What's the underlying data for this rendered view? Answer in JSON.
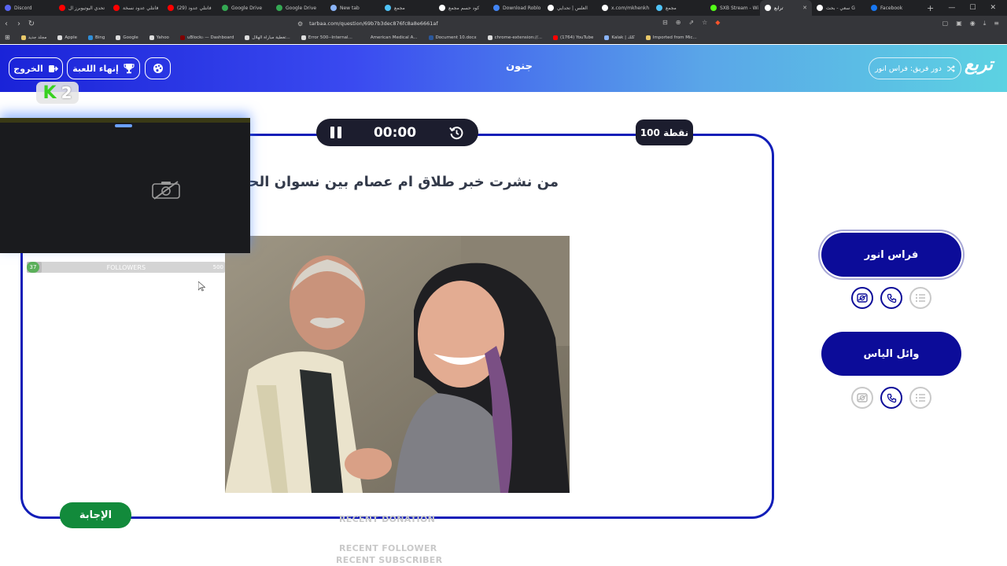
{
  "browser": {
    "tabs": [
      {
        "label": "Discord",
        "color": "#5865f2",
        "active": false
      },
      {
        "label": "تحدي اليوتيوبرز ال",
        "color": "#ff0000",
        "active": false
      },
      {
        "label": "فانتلي عدود نسخة",
        "color": "#ff0000",
        "active": false
      },
      {
        "label": "(29) فانتلي عدود",
        "color": "#ff0000",
        "active": false
      },
      {
        "label": "Google Drive",
        "color": "#34a853",
        "active": false
      },
      {
        "label": "Google Drive",
        "color": "#34a853",
        "active": false
      },
      {
        "label": "New tab",
        "color": "#8ab4f8",
        "active": false
      },
      {
        "label": "مجمع",
        "color": "#4fc3f7",
        "active": false
      },
      {
        "label": "كود حسم مجمع",
        "color": "#ffffff",
        "active": false
      },
      {
        "label": "Download Roblo",
        "color": "#4285f4",
        "active": false
      },
      {
        "label": "العلس | تحدايي",
        "color": "#ffffff",
        "active": false
      },
      {
        "label": "x.com/mkhenkh",
        "color": "#ffffff",
        "active": false
      },
      {
        "label": "مجمع",
        "color": "#4fc3f7",
        "active": false
      },
      {
        "label": "SXB Stream - Wi",
        "color": "#53fc18",
        "active": false
      },
      {
        "label": "ترابع",
        "color": "#ffffff",
        "active": true
      },
      {
        "label": "سعي - بحث G",
        "color": "#ffffff",
        "active": false
      },
      {
        "label": "Facebook",
        "color": "#1877f2",
        "active": false
      }
    ],
    "url": "tarbaa.com/question/69b7b3dec876fc8a8e6661af",
    "bookmarks": [
      {
        "label": "مجلد جديد",
        "color": "#e8c86a"
      },
      {
        "label": "Apple",
        "color": "#dddddd"
      },
      {
        "label": "Bing",
        "color": "#2f8ed8"
      },
      {
        "label": "Google",
        "color": "#dddddd"
      },
      {
        "label": "Yahoo",
        "color": "#dddddd"
      },
      {
        "label": "uBlock₀ — Dashboard",
        "color": "#800000"
      },
      {
        "label": "تغطية مباراة الهلال...",
        "color": "#dddddd"
      },
      {
        "label": "Error 500--Internal...",
        "color": "#dddddd"
      },
      {
        "label": "American Medical A...",
        "color": "#35363a"
      },
      {
        "label": "Document 10.docx",
        "color": "#2b579a"
      },
      {
        "label": "chrome-extension://...",
        "color": "#dddddd"
      },
      {
        "label": "(1764) YouTube",
        "color": "#ff0000"
      },
      {
        "label": "Kalak | كلك",
        "color": "#8ab4f8"
      },
      {
        "label": "Imported from Mic...",
        "color": "#e8c86a"
      }
    ]
  },
  "header": {
    "title": "جنون",
    "logout_label": "الخروج",
    "end_game_label": "إنهاء اللعبة",
    "logo_text": "تربع",
    "turn_label": "دور فريق: فراس انور"
  },
  "question": {
    "timer": "00:00",
    "points": "100 نقطة",
    "text": "من نشرت خبر طلاق ام عصام بين نسوان الحارة",
    "answer_label": "الإجابة"
  },
  "stream": {
    "k_count": "2",
    "k_letter": "K",
    "followers_count": "37",
    "followers_label": "FOLLOWERS",
    "followers_goal": "500",
    "followers_progress": 0.074,
    "recent_donation": "RECENT DONATION",
    "recent_follower": "RECENT FOLLOWER",
    "recent_subscriber": "RECENT SUBSCRIBER"
  },
  "teams": [
    {
      "name": "فراس انور",
      "active": true,
      "aids": {
        "skip": true,
        "call": true,
        "list": false
      }
    },
    {
      "name": "وائل الياس",
      "active": false,
      "aids": {
        "skip": false,
        "call": true,
        "list": false
      }
    }
  ],
  "colors": {
    "primary": "#0c0c99",
    "card_border": "#121eb8",
    "answer": "#128a3b",
    "dark_pill": "#1c1d2e"
  }
}
